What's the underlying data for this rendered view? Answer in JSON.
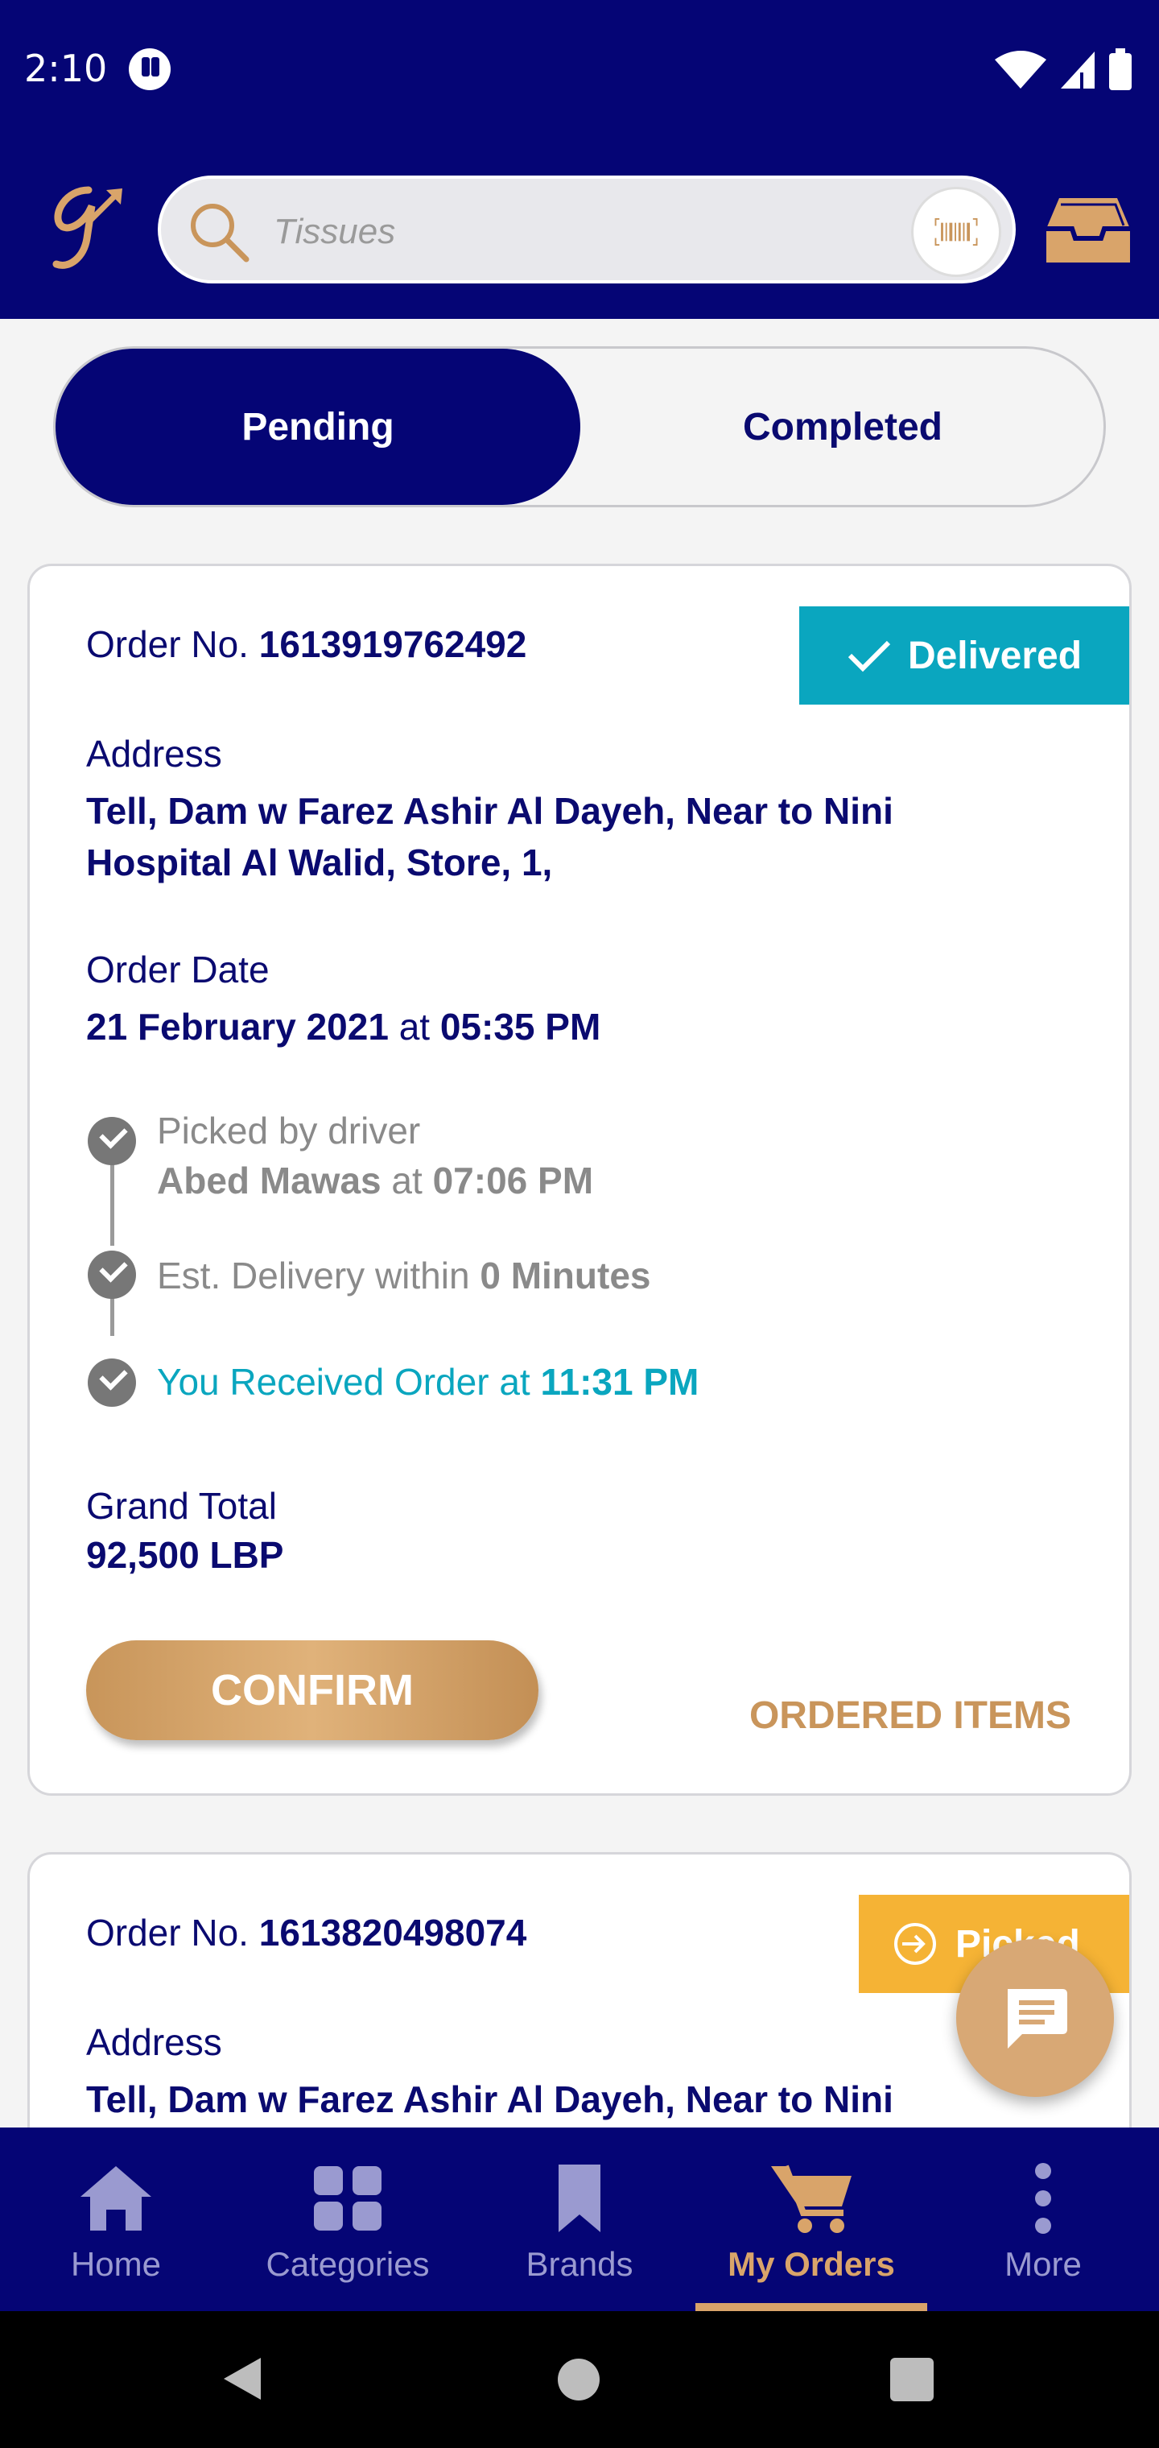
{
  "status_bar": {
    "time": "2:10"
  },
  "header": {
    "search_placeholder": "Tissues"
  },
  "tabs": [
    {
      "label": "Pending",
      "active": true
    },
    {
      "label": "Completed",
      "active": false
    }
  ],
  "orders": [
    {
      "order_no_label": "Order No.",
      "order_no": "1613919762492",
      "status": "Delivered",
      "address_label": "Address",
      "address_line1": "Tell, Dam w Farez Ashir Al Dayeh, Near to Nini",
      "address_line2": "Hospital Al Walid, Store, 1,",
      "order_date_label": "Order Date",
      "order_date": "21 February 2021",
      "at": "at",
      "order_time": "05:35 PM",
      "timeline": {
        "picked_label": "Picked by driver",
        "driver": "Abed Mawas",
        "picked_at": "at",
        "picked_time": "07:06 PM",
        "est_label": "Est. Delivery within",
        "est_value": "0 Minutes",
        "received_label": "You Received Order at",
        "received_time": "11:31 PM"
      },
      "grand_total_label": "Grand Total",
      "grand_total": "92,500 LBP",
      "confirm_label": "CONFIRM",
      "ordered_items_label": "ORDERED ITEMS"
    },
    {
      "order_no_label": "Order No.",
      "order_no": "1613820498074",
      "status": "Picked",
      "address_label": "Address",
      "address_line1": "Tell, Dam w Farez Ashir Al Dayeh, Near to Nini"
    }
  ],
  "bottom_nav": [
    {
      "label": "Home",
      "icon": "home-icon"
    },
    {
      "label": "Categories",
      "icon": "grid-icon"
    },
    {
      "label": "Brands",
      "icon": "bookmark-icon"
    },
    {
      "label": "My Orders",
      "icon": "cart-icon",
      "active": true
    },
    {
      "label": "More",
      "icon": "more-vertical-icon"
    }
  ],
  "colors": {
    "navy": "#050575",
    "gold": "#d9a46a",
    "teal": "#0aa6bf",
    "amber": "#f5b335"
  }
}
